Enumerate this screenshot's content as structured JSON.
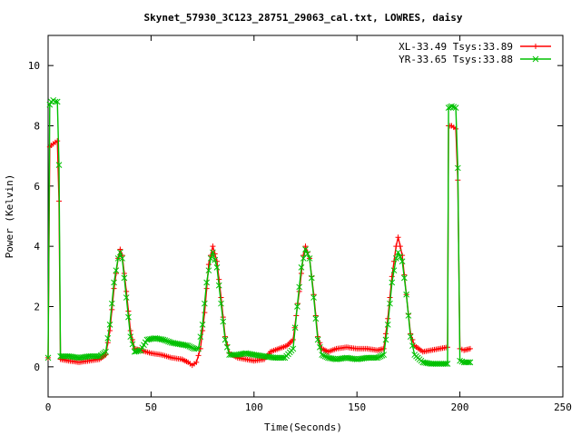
{
  "chart_data": {
    "type": "line",
    "title": "Skynet_57930_3C123_28751_29063_cal.txt, LOWRES, daisy",
    "xlabel": "Time(Seconds)",
    "ylabel": "Power (Kelvin)",
    "xlim": [
      0,
      250
    ],
    "ylim": [
      -1,
      11
    ],
    "xticks": [
      0,
      50,
      100,
      150,
      200,
      250
    ],
    "yticks": [
      0,
      2,
      4,
      6,
      8,
      10
    ],
    "grid": false,
    "legend_position": "top-right",
    "series": [
      {
        "name": "XL-33.49 Tsys:33.89",
        "color": "#ff0000",
        "marker": "plus",
        "points": [
          [
            0,
            0.3
          ],
          [
            0.8,
            7.3
          ],
          [
            1.5,
            7.35
          ],
          [
            2.5,
            7.4
          ],
          [
            3.5,
            7.45
          ],
          [
            4.5,
            7.5
          ],
          [
            5.3,
            5.5
          ],
          [
            6,
            0.25
          ],
          [
            10,
            0.2
          ],
          [
            15,
            0.15
          ],
          [
            20,
            0.2
          ],
          [
            25,
            0.25
          ],
          [
            28,
            0.4
          ],
          [
            30,
            1.2
          ],
          [
            32,
            2.6
          ],
          [
            34,
            3.6
          ],
          [
            35,
            3.9
          ],
          [
            36,
            3.7
          ],
          [
            38,
            2.5
          ],
          [
            40,
            1.2
          ],
          [
            42,
            0.6
          ],
          [
            45,
            0.55
          ],
          [
            50,
            0.45
          ],
          [
            55,
            0.4
          ],
          [
            60,
            0.3
          ],
          [
            65,
            0.25
          ],
          [
            68,
            0.15
          ],
          [
            70,
            0.05
          ],
          [
            72,
            0.15
          ],
          [
            74,
            0.6
          ],
          [
            76,
            1.8
          ],
          [
            78,
            3.4
          ],
          [
            80,
            4.0
          ],
          [
            82,
            3.5
          ],
          [
            84,
            2.3
          ],
          [
            86,
            1.0
          ],
          [
            88,
            0.45
          ],
          [
            92,
            0.3
          ],
          [
            96,
            0.25
          ],
          [
            100,
            0.2
          ],
          [
            105,
            0.25
          ],
          [
            108,
            0.5
          ],
          [
            112,
            0.6
          ],
          [
            116,
            0.7
          ],
          [
            119,
            0.9
          ],
          [
            122,
            2.5
          ],
          [
            124,
            3.7
          ],
          [
            125,
            4.0
          ],
          [
            127,
            3.6
          ],
          [
            129,
            2.4
          ],
          [
            131,
            1.0
          ],
          [
            133,
            0.6
          ],
          [
            136,
            0.5
          ],
          [
            140,
            0.6
          ],
          [
            145,
            0.65
          ],
          [
            150,
            0.6
          ],
          [
            155,
            0.6
          ],
          [
            160,
            0.55
          ],
          [
            163,
            0.6
          ],
          [
            165,
            1.6
          ],
          [
            167,
            3.0
          ],
          [
            169,
            4.0
          ],
          [
            170,
            4.3
          ],
          [
            172,
            3.7
          ],
          [
            174,
            2.4
          ],
          [
            176,
            1.1
          ],
          [
            178,
            0.7
          ],
          [
            182,
            0.5
          ],
          [
            186,
            0.55
          ],
          [
            190,
            0.6
          ],
          [
            194,
            0.65
          ],
          [
            194.5,
            8.0
          ],
          [
            196,
            8.0
          ],
          [
            198,
            7.9
          ],
          [
            199,
            6.2
          ],
          [
            200,
            0.6
          ],
          [
            202,
            0.55
          ],
          [
            205,
            0.6
          ]
        ]
      },
      {
        "name": "YR-33.65 Tsys:33.88",
        "color": "#00c000",
        "marker": "cross",
        "points": [
          [
            0,
            0.3
          ],
          [
            0.8,
            8.7
          ],
          [
            1.5,
            8.8
          ],
          [
            2.5,
            8.85
          ],
          [
            3.5,
            8.8
          ],
          [
            4.5,
            8.8
          ],
          [
            5.3,
            6.7
          ],
          [
            6,
            0.35
          ],
          [
            10,
            0.35
          ],
          [
            15,
            0.3
          ],
          [
            20,
            0.35
          ],
          [
            25,
            0.35
          ],
          [
            28,
            0.5
          ],
          [
            30,
            1.4
          ],
          [
            32,
            2.8
          ],
          [
            34,
            3.6
          ],
          [
            35,
            3.8
          ],
          [
            36,
            3.6
          ],
          [
            38,
            2.3
          ],
          [
            40,
            1.0
          ],
          [
            42,
            0.5
          ],
          [
            45,
            0.55
          ],
          [
            48,
            0.9
          ],
          [
            52,
            0.95
          ],
          [
            56,
            0.9
          ],
          [
            60,
            0.8
          ],
          [
            64,
            0.75
          ],
          [
            68,
            0.7
          ],
          [
            71,
            0.6
          ],
          [
            73,
            0.6
          ],
          [
            75,
            1.4
          ],
          [
            77,
            2.8
          ],
          [
            79,
            3.6
          ],
          [
            80,
            3.8
          ],
          [
            82,
            3.3
          ],
          [
            84,
            2.1
          ],
          [
            86,
            0.9
          ],
          [
            88,
            0.4
          ],
          [
            92,
            0.4
          ],
          [
            96,
            0.45
          ],
          [
            100,
            0.4
          ],
          [
            105,
            0.35
          ],
          [
            110,
            0.3
          ],
          [
            115,
            0.3
          ],
          [
            119,
            0.6
          ],
          [
            121,
            2.0
          ],
          [
            123,
            3.3
          ],
          [
            125,
            3.9
          ],
          [
            127,
            3.6
          ],
          [
            129,
            2.3
          ],
          [
            131,
            0.9
          ],
          [
            133,
            0.4
          ],
          [
            136,
            0.3
          ],
          [
            140,
            0.25
          ],
          [
            145,
            0.3
          ],
          [
            150,
            0.25
          ],
          [
            155,
            0.3
          ],
          [
            160,
            0.3
          ],
          [
            163,
            0.4
          ],
          [
            165,
            1.4
          ],
          [
            167,
            2.8
          ],
          [
            169,
            3.6
          ],
          [
            170,
            3.8
          ],
          [
            172,
            3.5
          ],
          [
            174,
            2.4
          ],
          [
            176,
            1.0
          ],
          [
            178,
            0.4
          ],
          [
            182,
            0.15
          ],
          [
            186,
            0.1
          ],
          [
            190,
            0.1
          ],
          [
            194,
            0.1
          ],
          [
            194.5,
            8.6
          ],
          [
            196,
            8.65
          ],
          [
            198,
            8.6
          ],
          [
            199,
            6.6
          ],
          [
            200,
            0.2
          ],
          [
            202,
            0.15
          ],
          [
            205,
            0.15
          ]
        ]
      }
    ]
  }
}
